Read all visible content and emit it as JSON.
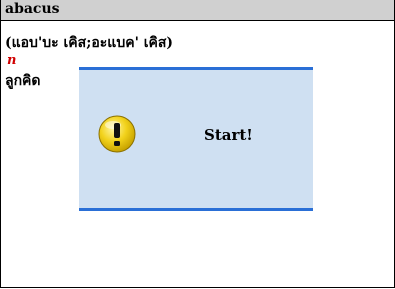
{
  "window": {
    "title": "abacus"
  },
  "entry": {
    "pronunciation": "(แอบ'บะ เคิส;อะแบค' เคิส)",
    "part_of_speech": "n",
    "meaning": "ลูกคิด"
  },
  "dialog": {
    "message": "Start!",
    "icon": "exclamation-icon"
  },
  "colors": {
    "title_bar": "#d0d0d0",
    "part_of_speech": "#d00000",
    "dialog_background": "#cfe0f2",
    "dialog_accent": "#2a6fd6",
    "icon_yellow": "#f2d21b"
  }
}
